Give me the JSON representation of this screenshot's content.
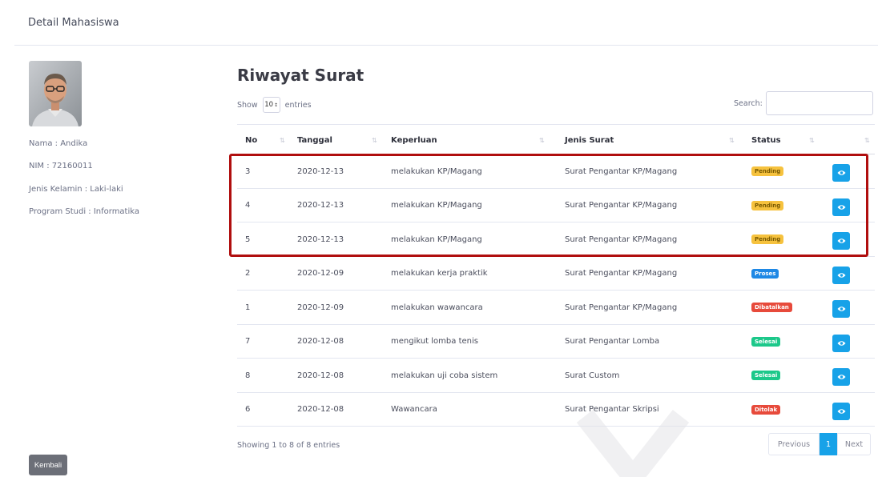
{
  "header": {
    "title": "Detail Mahasiswa"
  },
  "student": {
    "nama": "Nama : Andika",
    "nim": "NIM : 72160011",
    "jenis_kelamin": "Jenis Kelamin : Laki-laki",
    "program_studi": "Program Studi : Informatika"
  },
  "back_button": "Kembali",
  "main": {
    "title": "Riwayat Surat",
    "show_label": "Show",
    "length_value": "10",
    "entries_label": "entries",
    "search_label": "Search:",
    "search_value": ""
  },
  "table": {
    "headers": [
      "No",
      "Tanggal",
      "Keperluan",
      "Jenis Surat",
      "Status",
      ""
    ],
    "rows": [
      {
        "no": "3",
        "tanggal": "2020-12-13",
        "keperluan": "melakukan KP/Magang",
        "jenis": "Surat Pengantar KP/Magang",
        "status": "Pending"
      },
      {
        "no": "4",
        "tanggal": "2020-12-13",
        "keperluan": "melakukan KP/Magang",
        "jenis": "Surat Pengantar KP/Magang",
        "status": "Pending"
      },
      {
        "no": "5",
        "tanggal": "2020-12-13",
        "keperluan": "melakukan KP/Magang",
        "jenis": "Surat Pengantar KP/Magang",
        "status": "Pending"
      },
      {
        "no": "2",
        "tanggal": "2020-12-09",
        "keperluan": "melakukan kerja praktik",
        "jenis": "Surat Pengantar KP/Magang",
        "status": "Proses"
      },
      {
        "no": "1",
        "tanggal": "2020-12-09",
        "keperluan": "melakukan wawancara",
        "jenis": "Surat Pengantar KP/Magang",
        "status": "Dibatalkan"
      },
      {
        "no": "7",
        "tanggal": "2020-12-08",
        "keperluan": "mengikut lomba tenis",
        "jenis": "Surat Pengantar Lomba",
        "status": "Selesai"
      },
      {
        "no": "8",
        "tanggal": "2020-12-08",
        "keperluan": "melakukan uji coba sistem",
        "jenis": "Surat Custom",
        "status": "Selesai"
      },
      {
        "no": "6",
        "tanggal": "2020-12-08",
        "keperluan": "Wawancara",
        "jenis": "Surat Pengantar Skripsi",
        "status": "Ditolak"
      }
    ]
  },
  "status_colors": {
    "Pending": "#f6c23e",
    "Proses": "#1e88e5",
    "Dibatalkan": "#e74a3b",
    "Selesai": "#1cc88a",
    "Ditolak": "#e74a3b"
  },
  "footer": {
    "showing": "Showing 1 to 8 of 8 entries",
    "previous": "Previous",
    "page": "1",
    "next": "Next"
  },
  "colors": {
    "accent": "#17a2e8",
    "highlight": "#b00e0e"
  },
  "icons": {
    "view": "eye-icon",
    "sort": "sort-icon"
  }
}
